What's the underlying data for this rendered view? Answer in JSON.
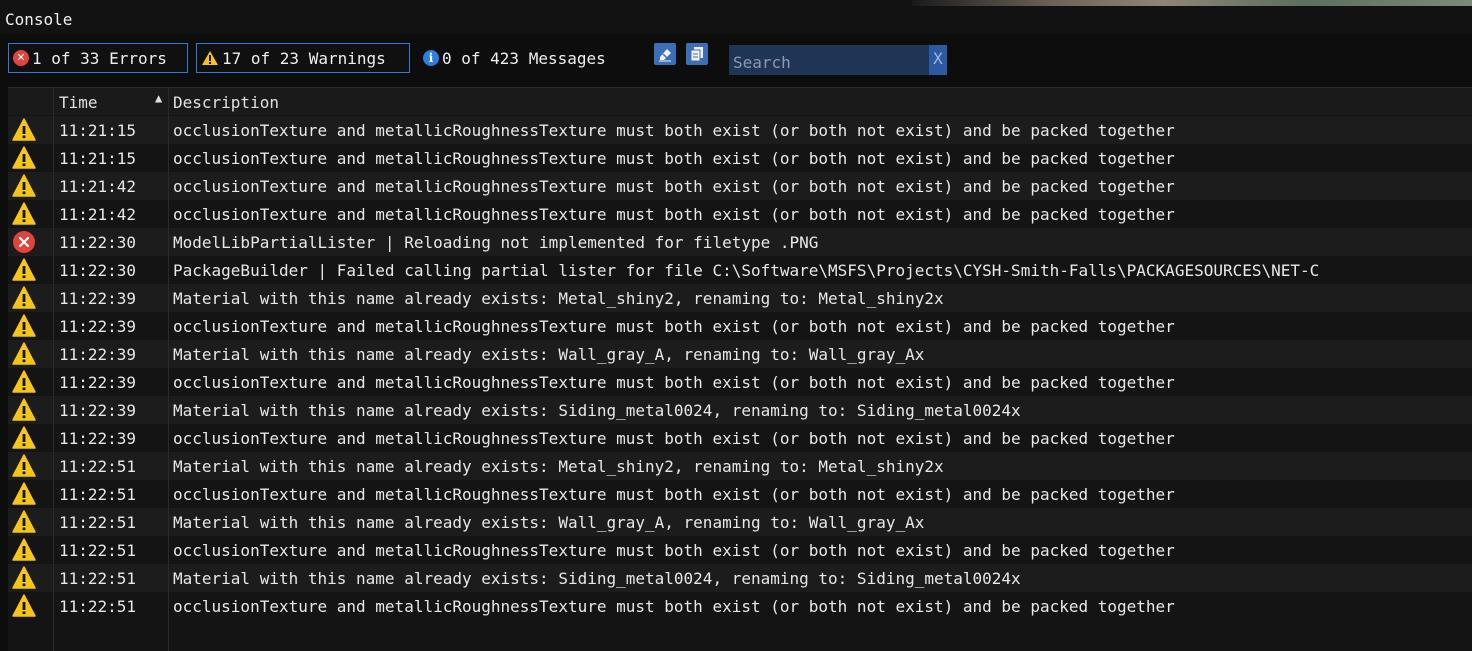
{
  "window": {
    "title": "Console"
  },
  "toolbar": {
    "errors_label": "1 of 33 Errors",
    "warnings_label": "17 of 23 Warnings",
    "messages_label": "0 of 423 Messages",
    "search_placeholder": "Search",
    "search_value": "",
    "clear_label": "X"
  },
  "table": {
    "columns": {
      "time": "Time",
      "description": "Description"
    },
    "rows": [
      {
        "type": "warning",
        "time": "11:21:15",
        "description": "occlusionTexture and metallicRoughnessTexture must both exist (or both not exist) and be packed together"
      },
      {
        "type": "warning",
        "time": "11:21:15",
        "description": "occlusionTexture and metallicRoughnessTexture must both exist (or both not exist) and be packed together"
      },
      {
        "type": "warning",
        "time": "11:21:42",
        "description": "occlusionTexture and metallicRoughnessTexture must both exist (or both not exist) and be packed together"
      },
      {
        "type": "warning",
        "time": "11:21:42",
        "description": "occlusionTexture and metallicRoughnessTexture must both exist (or both not exist) and be packed together"
      },
      {
        "type": "error",
        "time": "11:22:30",
        "description": "ModelLibPartialLister | Reloading not implemented for filetype .PNG"
      },
      {
        "type": "warning",
        "time": "11:22:30",
        "description": "PackageBuilder | Failed calling partial lister for file C:\\Software\\MSFS\\Projects\\CYSH-Smith-Falls\\PACKAGESOURCES\\NET-C"
      },
      {
        "type": "warning",
        "time": "11:22:39",
        "description": "Material with this name already exists: Metal_shiny2, renaming to: Metal_shiny2x"
      },
      {
        "type": "warning",
        "time": "11:22:39",
        "description": "occlusionTexture and metallicRoughnessTexture must both exist (or both not exist) and be packed together"
      },
      {
        "type": "warning",
        "time": "11:22:39",
        "description": "Material with this name already exists: Wall_gray_A, renaming to: Wall_gray_Ax"
      },
      {
        "type": "warning",
        "time": "11:22:39",
        "description": "occlusionTexture and metallicRoughnessTexture must both exist (or both not exist) and be packed together"
      },
      {
        "type": "warning",
        "time": "11:22:39",
        "description": "Material with this name already exists: Siding_metal0024, renaming to: Siding_metal0024x"
      },
      {
        "type": "warning",
        "time": "11:22:39",
        "description": "occlusionTexture and metallicRoughnessTexture must both exist (or both not exist) and be packed together"
      },
      {
        "type": "warning",
        "time": "11:22:51",
        "description": "Material with this name already exists: Metal_shiny2, renaming to: Metal_shiny2x"
      },
      {
        "type": "warning",
        "time": "11:22:51",
        "description": "occlusionTexture and metallicRoughnessTexture must both exist (or both not exist) and be packed together"
      },
      {
        "type": "warning",
        "time": "11:22:51",
        "description": "Material with this name already exists: Wall_gray_A, renaming to: Wall_gray_Ax"
      },
      {
        "type": "warning",
        "time": "11:22:51",
        "description": "occlusionTexture and metallicRoughnessTexture must both exist (or both not exist) and be packed together"
      },
      {
        "type": "warning",
        "time": "11:22:51",
        "description": "Material with this name already exists: Siding_metal0024, renaming to: Siding_metal0024x"
      },
      {
        "type": "warning",
        "time": "11:22:51",
        "description": "occlusionTexture and metallicRoughnessTexture must both exist (or both not exist) and be packed together"
      }
    ]
  },
  "icons": {
    "errors_filter": "error-circle-icon",
    "warnings_filter": "warning-triangle-icon",
    "messages_filter": "info-circle-icon",
    "clear_console": "eraser-icon",
    "copy_console": "copy-icon",
    "sort": "sort-ascending-icon"
  },
  "colors": {
    "error": "#e0443e",
    "warning": "#f5c518",
    "info": "#2f7de1",
    "filter_border": "#3a78d8",
    "search_bg": "#1f3556"
  }
}
